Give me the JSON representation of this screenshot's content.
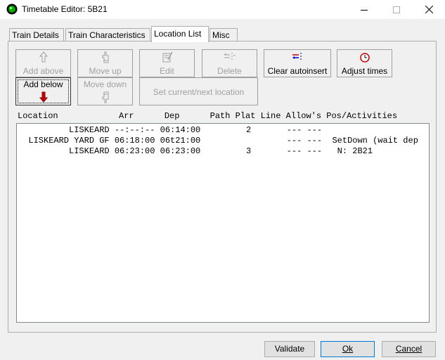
{
  "window": {
    "title": "Timetable Editor: 5B21",
    "accent_icon_color": "#00a000"
  },
  "tabs": [
    {
      "label": "Train Details",
      "mnemonic": "D"
    },
    {
      "label": "Train Characteristics",
      "mnemonic": "a"
    },
    {
      "label": "Location List",
      "mnemonic": ""
    },
    {
      "label": "Misc",
      "mnemonic": ""
    }
  ],
  "active_tab": "Location List",
  "toolbar": {
    "add_above": "Add above",
    "move_up": "Move up",
    "edit": "Edit",
    "delete": "Delete",
    "clear_autoinsert": "Clear autoinsert",
    "adjust_times": "Adjust times",
    "add_below": "Add below",
    "move_down": "Move down",
    "set_current_next": "Set current/next location"
  },
  "list": {
    "header": "Location            Arr      Dep      Path Plat Line Allow's Pos/Activities",
    "rows": [
      "          LISKEARD --:--:-- 06:14:00         2       --- ---",
      "  LISKEARD YARD GF 06:18:00 06t21:00                 --- ---  SetDown (wait dep",
      "          LISKEARD 06:23:00 06:23:00         3       --- ---   N: 2B21"
    ]
  },
  "footer": {
    "validate": "Validate",
    "ok": "Ok",
    "cancel": "Cancel"
  }
}
